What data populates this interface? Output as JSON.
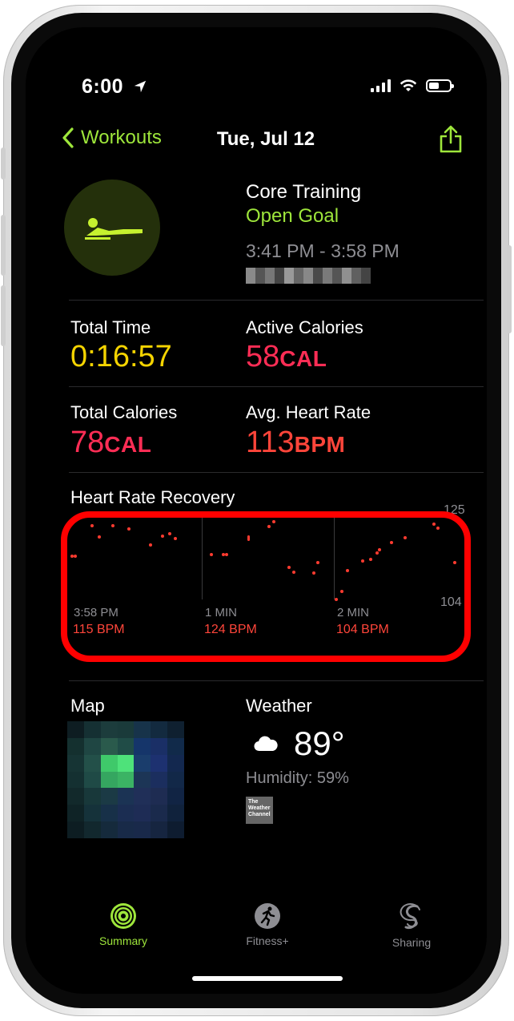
{
  "status_bar": {
    "time": "6:00"
  },
  "nav": {
    "back_label": "Workouts",
    "title": "Tue, Jul 12"
  },
  "workout": {
    "name": "Core Training",
    "goal": "Open Goal",
    "time_range": "3:41 PM - 3:58 PM"
  },
  "metrics": {
    "total_time": {
      "label": "Total Time",
      "value": "0:16:57"
    },
    "active_calories": {
      "label": "Active Calories",
      "value": "58",
      "unit": "CAL"
    },
    "total_calories": {
      "label": "Total Calories",
      "value": "78",
      "unit": "CAL"
    },
    "avg_heart_rate": {
      "label": "Avg. Heart Rate",
      "value": "113",
      "unit": "BPM"
    }
  },
  "heart_rate_recovery": {
    "title": "Heart Rate Recovery",
    "axis_top": "125",
    "axis_bottom": "104",
    "segments": [
      {
        "time": "3:58 PM",
        "bpm": "115 BPM"
      },
      {
        "time": "1 MIN",
        "bpm": "124 BPM"
      },
      {
        "time": "2 MIN",
        "bpm": "104 BPM"
      }
    ]
  },
  "map": {
    "label": "Map"
  },
  "weather": {
    "label": "Weather",
    "temperature": "89°",
    "humidity": "Humidity: 59%",
    "logo_text": "The Weather Channel"
  },
  "tabs": [
    {
      "label": "Summary",
      "active": true
    },
    {
      "label": "Fitness+",
      "active": false
    },
    {
      "label": "Sharing",
      "active": false
    }
  ],
  "colors": {
    "accent_green": "#9ee63b",
    "time_yellow": "#f5d400",
    "calorie_red": "#ff2d55",
    "heart_red": "#ff453a"
  }
}
